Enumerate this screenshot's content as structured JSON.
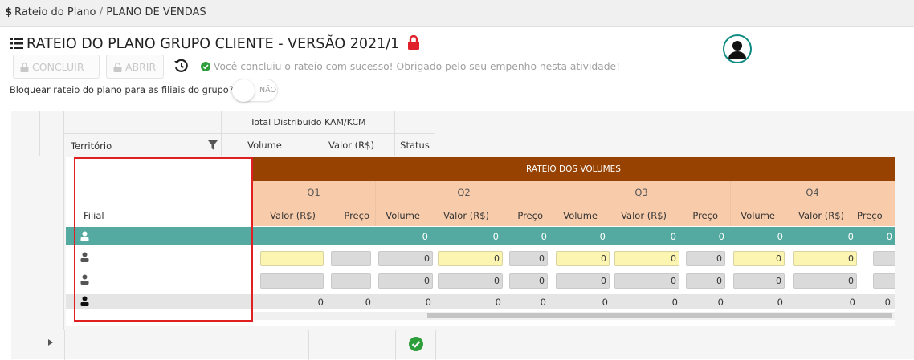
{
  "breadcrumb": {
    "parent": "Rateio do Plano",
    "separator": "/",
    "current": "PLANO DE VENDAS"
  },
  "header": {
    "title": "RATEIO DO PLANO GRUPO CLIENTE - VERSÃO 2021/1"
  },
  "toolbar": {
    "concluir_label": "CONCLUIR",
    "abrir_label": "ABRIR",
    "message": "Você concluiu o rateio com sucesso! Obrigado pelo seu empenho nesta atividade!"
  },
  "block_option": {
    "label": "Bloquear rateio do plano para as filiais do grupo?",
    "toggle_label": "NÃO"
  },
  "grid": {
    "group_header": "Total Distribuido KAM/KCM",
    "territory_label": "Território",
    "volume_label": "Volume",
    "valor_label": "Valor (R$)",
    "status_label": "Status"
  },
  "inner": {
    "filial_label": "Filial",
    "section_title": "RATEIO DOS VOLUMES",
    "quarters": [
      "Q1",
      "Q2",
      "Q3",
      "Q4"
    ],
    "columns": [
      "Valor (R$)",
      "Preço",
      "Volume",
      "Valor (R$)",
      "Preço",
      "Volume",
      "Valor (R$)",
      "Preço",
      "Volume",
      "Valor (R$)",
      "Preço"
    ],
    "rows": {
      "teal": [
        "0",
        "0",
        "0",
        "0",
        "0",
        "0",
        "0",
        "0",
        "0"
      ],
      "input1": [
        "",
        "",
        "0",
        "0",
        "0",
        "0",
        "0",
        "0",
        "0",
        "0",
        "0"
      ],
      "input2": [
        "",
        "",
        "0",
        "0",
        "0",
        "0",
        "0",
        "0",
        "0",
        "0",
        "0"
      ],
      "total": [
        "0",
        "0",
        "0",
        "0",
        "0",
        "0",
        "0",
        "0",
        "0",
        "0",
        "0"
      ]
    }
  },
  "colors": {
    "teal": "#54aaa0",
    "brown": "#974200",
    "peach": "#f8ccab",
    "yellow": "#fbf5b1",
    "red": "#e02020",
    "green": "#2e9e3a"
  }
}
